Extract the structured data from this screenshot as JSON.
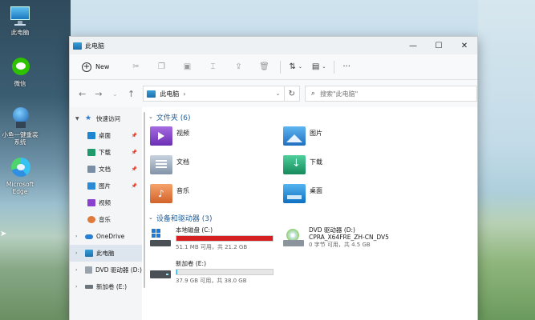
{
  "desktop": {
    "icons": [
      {
        "label": "此电脑",
        "icon": "computer-icon"
      },
      {
        "label": "微信",
        "icon": "wechat-icon"
      },
      {
        "label": "小鱼一键重装系统",
        "icon": "installer-icon"
      },
      {
        "label": "Microsoft Edge",
        "icon": "edge-icon"
      }
    ]
  },
  "window": {
    "title": "此电脑",
    "controls": {
      "minimize": "—",
      "maximize": "☐",
      "close": "✕"
    }
  },
  "toolbar": {
    "new_label": "New",
    "sort_label": "⇅",
    "view_label": "▤",
    "more_label": "···"
  },
  "address": {
    "location": "此电脑",
    "separator": "›",
    "search_placeholder": "搜索\"此电脑\""
  },
  "sidebar": {
    "items": [
      {
        "label": "快速访问",
        "icon": "star-icon",
        "level": 0,
        "expanded": true,
        "pinned": false
      },
      {
        "label": "桌面",
        "icon": "desktop-folder-icon",
        "level": 1,
        "pinned": true
      },
      {
        "label": "下载",
        "icon": "download-folder-icon",
        "level": 1,
        "pinned": true
      },
      {
        "label": "文档",
        "icon": "documents-folder-icon",
        "level": 1,
        "pinned": true
      },
      {
        "label": "图片",
        "icon": "pictures-folder-icon",
        "level": 1,
        "pinned": true
      },
      {
        "label": "视频",
        "icon": "videos-folder-icon",
        "level": 1,
        "pinned": false
      },
      {
        "label": "音乐",
        "icon": "music-folder-icon",
        "level": 1,
        "pinned": false
      },
      {
        "label": "OneDrive",
        "icon": "onedrive-cloud-icon",
        "level": 0
      },
      {
        "label": "此电脑",
        "icon": "computer-icon",
        "level": 0,
        "selected": true
      },
      {
        "label": "DVD 驱动器 (D:)",
        "icon": "dvd-drive-icon",
        "level": 0
      },
      {
        "label": "新加卷 (E:)",
        "icon": "drive-icon",
        "level": 0
      }
    ]
  },
  "content": {
    "folders_header": "文件夹 (6)",
    "folders": [
      {
        "label": "视频",
        "icon": "videos-folder-icon",
        "color": "#8b3fd1"
      },
      {
        "label": "图片",
        "icon": "pictures-folder-icon",
        "color": "#2b8ad6"
      },
      {
        "label": "文档",
        "icon": "documents-folder-icon",
        "color": "#7a8fa6"
      },
      {
        "label": "下载",
        "icon": "download-folder-icon",
        "color": "#1f9a6a"
      },
      {
        "label": "音乐",
        "icon": "music-folder-icon",
        "color": "#e07a3a"
      },
      {
        "label": "桌面",
        "icon": "desktop-folder-icon",
        "color": "#1e86d1"
      }
    ],
    "devices_header": "设备和驱动器 (3)",
    "drives": [
      {
        "name": "本地磁盘 (C:)",
        "free_text": "51.1 MB 可用，共 21.2 GB",
        "used_fraction": 0.998,
        "bar_color": "#d42020",
        "icon": "windows-drive-icon"
      },
      {
        "name": "DVD 驱动器 (D:)",
        "subtitle": "CPRA_X64FRE_ZH-CN_DV5",
        "free_text": "0 字节 可用，共 4.5 GB",
        "icon": "dvd-drive-icon"
      },
      {
        "name": "新加卷 (E:)",
        "free_text": "37.9 GB 可用，共 38.0 GB",
        "used_fraction": 0.003,
        "bar_color": "#26a0da",
        "icon": "drive-icon"
      }
    ]
  }
}
